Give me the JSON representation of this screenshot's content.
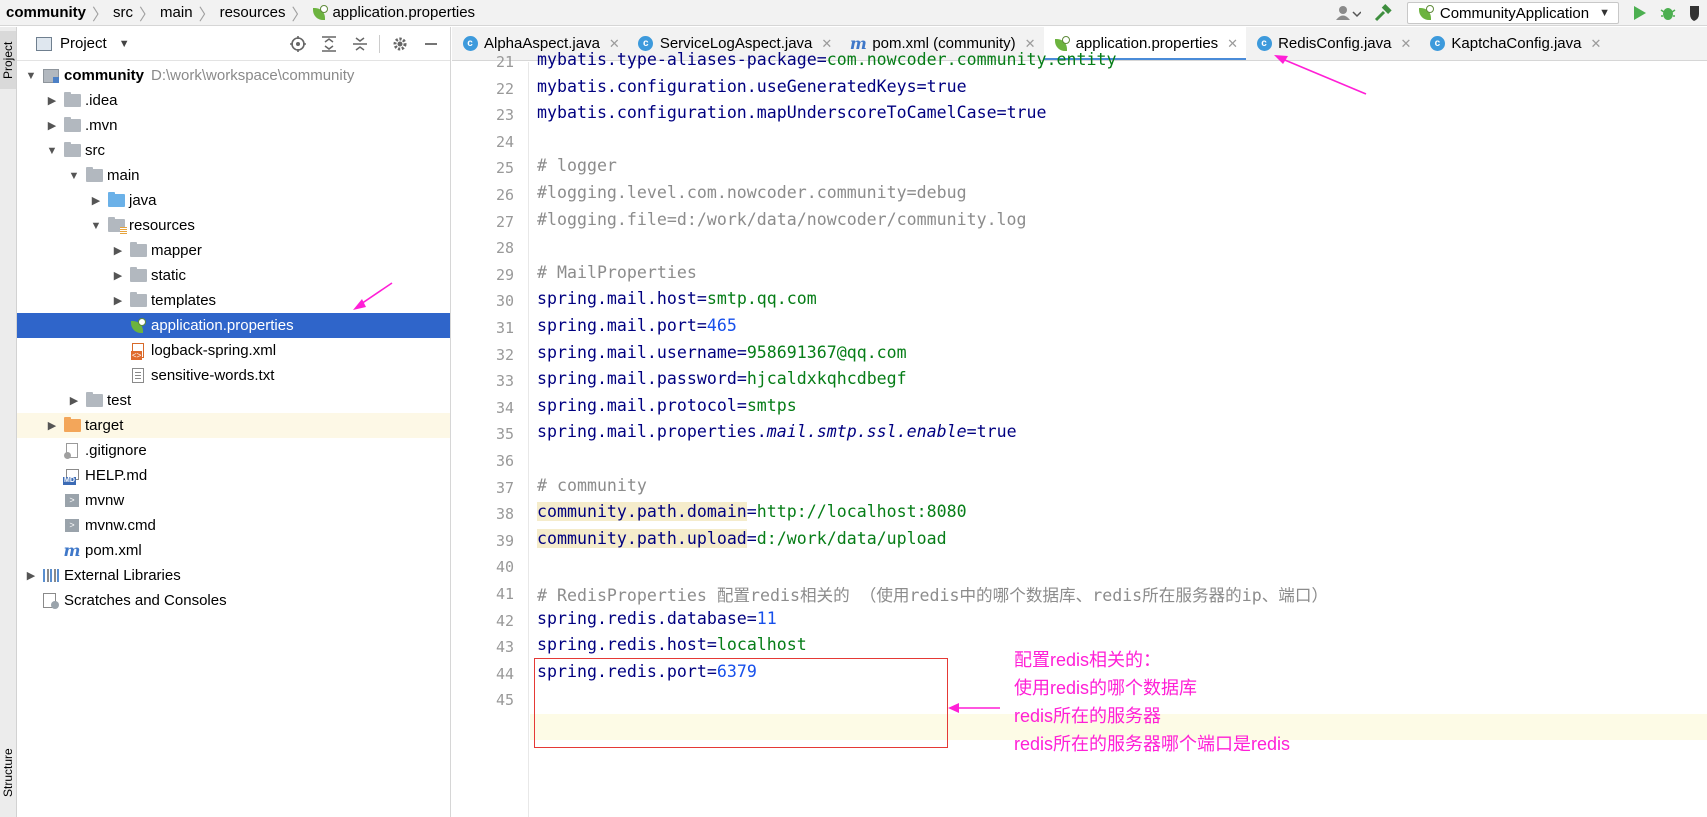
{
  "breadcrumb": [
    "community",
    "src",
    "main",
    "resources",
    "application.properties"
  ],
  "run_config": "CommunityApplication",
  "stripe": {
    "project": "Project",
    "structure": "Structure"
  },
  "project_panel": {
    "title": "Project"
  },
  "tree": [
    {
      "label": "community",
      "hint": "D:\\work\\workspace\\community",
      "depth": 0,
      "arrow": "down",
      "icon": "module"
    },
    {
      "label": ".idea",
      "depth": 1,
      "arrow": "right",
      "icon": "folder"
    },
    {
      "label": ".mvn",
      "depth": 1,
      "arrow": "right",
      "icon": "folder"
    },
    {
      "label": "src",
      "depth": 1,
      "arrow": "down",
      "icon": "folder"
    },
    {
      "label": "main",
      "depth": 2,
      "arrow": "down",
      "icon": "folder"
    },
    {
      "label": "java",
      "depth": 3,
      "arrow": "right",
      "icon": "folder-blue"
    },
    {
      "label": "resources",
      "depth": 3,
      "arrow": "down",
      "icon": "folder-resources"
    },
    {
      "label": "mapper",
      "depth": 4,
      "arrow": "right",
      "icon": "folder"
    },
    {
      "label": "static",
      "depth": 4,
      "arrow": "right",
      "icon": "folder"
    },
    {
      "label": "templates",
      "depth": 4,
      "arrow": "right",
      "icon": "folder"
    },
    {
      "label": "application.properties",
      "depth": 5,
      "arrow": "none",
      "icon": "spring-leaf",
      "selected": true
    },
    {
      "label": "logback-spring.xml",
      "depth": 5,
      "arrow": "none",
      "icon": "xml-file"
    },
    {
      "label": "sensitive-words.txt",
      "depth": 5,
      "arrow": "none",
      "icon": "text-file"
    },
    {
      "label": "test",
      "depth": 2,
      "arrow": "right",
      "icon": "folder"
    },
    {
      "label": "target",
      "depth": 1,
      "arrow": "right",
      "icon": "folder-orange"
    },
    {
      "label": ".gitignore",
      "depth": 2,
      "arrow": "none",
      "icon": "git-file"
    },
    {
      "label": "HELP.md",
      "depth": 2,
      "arrow": "none",
      "icon": "markdown-file"
    },
    {
      "label": "mvnw",
      "depth": 2,
      "arrow": "none",
      "icon": "shell-file"
    },
    {
      "label": "mvnw.cmd",
      "depth": 2,
      "arrow": "none",
      "icon": "shell-file"
    },
    {
      "label": "pom.xml",
      "depth": 2,
      "arrow": "none",
      "icon": "maven-file"
    },
    {
      "label": "External Libraries",
      "depth": 0,
      "arrow": "right",
      "icon": "libraries"
    },
    {
      "label": "Scratches and Consoles",
      "depth": 0,
      "arrow": "none",
      "icon": "scratches"
    }
  ],
  "tabs": [
    {
      "label": "AlphaAspect.java",
      "icon": "class-icon"
    },
    {
      "label": "ServiceLogAspect.java",
      "icon": "class-icon"
    },
    {
      "label": "pom.xml (community)",
      "icon": "maven-icon"
    },
    {
      "label": "application.properties",
      "icon": "spring-leaf-icon",
      "active": true
    },
    {
      "label": "RedisConfig.java",
      "icon": "class-icon"
    },
    {
      "label": "KaptchaConfig.java",
      "icon": "class-icon"
    }
  ],
  "editor": {
    "lines": [
      {
        "no": "21",
        "key": "mybatis.type-aliases-package",
        "value": "com.nowcoder.community.entity"
      },
      {
        "no": "22",
        "key": "mybatis.configuration.useGeneratedKeys",
        "value": "true"
      },
      {
        "no": "23",
        "key": "mybatis.configuration.mapUnderscoreToCamelCase",
        "value": "true"
      },
      {
        "no": "24"
      },
      {
        "no": "25",
        "comment": "# logger"
      },
      {
        "no": "26",
        "comment": "#logging.level.com.nowcoder.community=debug"
      },
      {
        "no": "27",
        "comment": "#logging.file=d:/work/data/nowcoder/community.log"
      },
      {
        "no": "28"
      },
      {
        "no": "29",
        "comment": "# MailProperties"
      },
      {
        "no": "30",
        "key": "spring.mail.host",
        "value": "smtp.qq.com"
      },
      {
        "no": "31",
        "key": "spring.mail.port",
        "value": "465"
      },
      {
        "no": "32",
        "key": "spring.mail.username",
        "value": "958691367@qq.com"
      },
      {
        "no": "33",
        "key": "spring.mail.password",
        "value": "hjcaldxkqhcdbegf"
      },
      {
        "no": "34",
        "key": "spring.mail.protocol",
        "value": "smtps"
      },
      {
        "no": "35",
        "key_prefix": "spring.mail.properties.",
        "key_italic": "mail.smtp.ssl.enable",
        "value": "true"
      },
      {
        "no": "36"
      },
      {
        "no": "37",
        "comment": "# community"
      },
      {
        "no": "38",
        "key": "community.path.domain",
        "value": "http://localhost:8080",
        "highlight": true
      },
      {
        "no": "39",
        "key": "community.path.upload",
        "value": "d:/work/data/upload",
        "highlight": true
      },
      {
        "no": "40"
      },
      {
        "no": "41",
        "comment": "# RedisProperties 配置redis相关的 （使用redis中的哪个数据库、redis所在服务器的ip、端口）"
      },
      {
        "no": "42",
        "key": "spring.redis.database",
        "value": "11"
      },
      {
        "no": "43",
        "key": "spring.redis.host",
        "value": "localhost"
      },
      {
        "no": "44",
        "key": "spring.redis.port",
        "value": "6379"
      },
      {
        "no": "45"
      }
    ]
  },
  "annotation": {
    "lines": [
      "配置redis相关的：",
      "使用redis的哪个数据库",
      "redis所在的服务器",
      "redis所在的服务器哪个端口是redis"
    ],
    "color": "#ff1fd6",
    "box_color": "#e53935"
  },
  "colors": {
    "selection": "#2f65ca",
    "key": "#000080",
    "value": "#067d17",
    "number": "#1750eb",
    "comment": "#8c8c8c"
  }
}
